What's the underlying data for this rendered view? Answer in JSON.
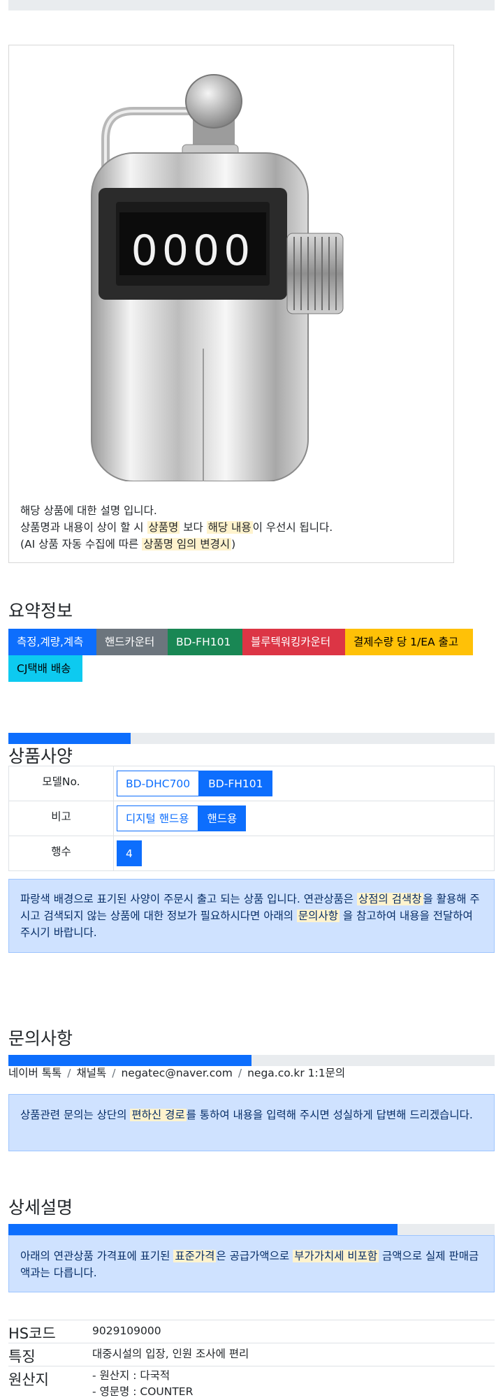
{
  "product_image": {
    "counter_digits": "0000"
  },
  "description": {
    "line1": "해당 상품에 대한 설명 입니다.",
    "line2_a": "상품명과 내용이 상이 할 시 ",
    "line2_hl1": "상품명",
    "line2_b": " 보다 ",
    "line2_hl2": "해당 내용",
    "line2_c": "이 우선시 됩니다.",
    "line3_a": "(AI 상품 자동 수집에 따른 ",
    "line3_hl": "상품명 임의 변경시",
    "line3_b": ")"
  },
  "summary": {
    "title": "요약정보",
    "badges": [
      "측정,계량,계측",
      "핸드카운터",
      "BD-FH101",
      "블루텍워킹카운터",
      "결제수량 당 1/EA 출고",
      "CJ택배 배송"
    ]
  },
  "spec": {
    "title": "상품사양",
    "progress_fraction": 0.25,
    "rows": [
      {
        "label": "모델No.",
        "options": [
          "BD-DHC700",
          "BD-FH101"
        ]
      },
      {
        "label": "비고",
        "options": [
          "디지털 핸드용",
          "핸드용"
        ]
      },
      {
        "label": "행수",
        "options": [
          "4"
        ]
      }
    ],
    "notice_a": "파랑색 배경으로 표기된 사양이 주문시 출고 되는 상품 입니다. 연관상품은 ",
    "notice_hl1": "상점의 검색창",
    "notice_b": "을 활용해 주시고 검색되지 않는 상품에 대한 정보가 필요하시다면 아래의 ",
    "notice_hl2": "문의사항",
    "notice_c": " 을 참고하여 내용을 전달하여 주시기 바랍니다."
  },
  "inquiry": {
    "title": "문의사항",
    "progress_fraction": 0.5,
    "contacts": [
      "네이버 톡톡",
      "채널톡",
      "negatec@naver.com",
      "nega.co.kr 1:1문의"
    ],
    "separator": "/",
    "notice_a": "상품관련 문의는 상단의 ",
    "notice_hl": "편하신 경로",
    "notice_b": "를 통하여 내용을 입력해 주시면 성실하게 답변해 드리겠습니다."
  },
  "detail": {
    "title": "상세설명",
    "progress_fraction": 0.75,
    "notice_a": "아래의 연관상품 가격표에 표기된 ",
    "notice_hl1": "표준가격",
    "notice_b": "은 공급가액으로 ",
    "notice_hl2": "부가가치세 비포함",
    "notice_c": " 금액으로 실제 판매금액과는 다릅니다.",
    "rows": [
      {
        "key": "HS코드",
        "value": "9029109000"
      },
      {
        "key": "특징",
        "value": "대중시설의 입장, 인원 조사에 편리"
      },
      {
        "key": "원산지",
        "value_lines": [
          "- 원산지 : 다국적",
          "- 영문명 : COUNTER"
        ]
      }
    ]
  },
  "colors": {
    "primary": "#0d6efd",
    "secondary": "#6c757d",
    "success": "#198754",
    "danger": "#dc3545",
    "warning": "#ffc107",
    "info": "#0dcaf0",
    "highlight": "#fff3cd",
    "alert_bg": "#cfe2ff"
  }
}
